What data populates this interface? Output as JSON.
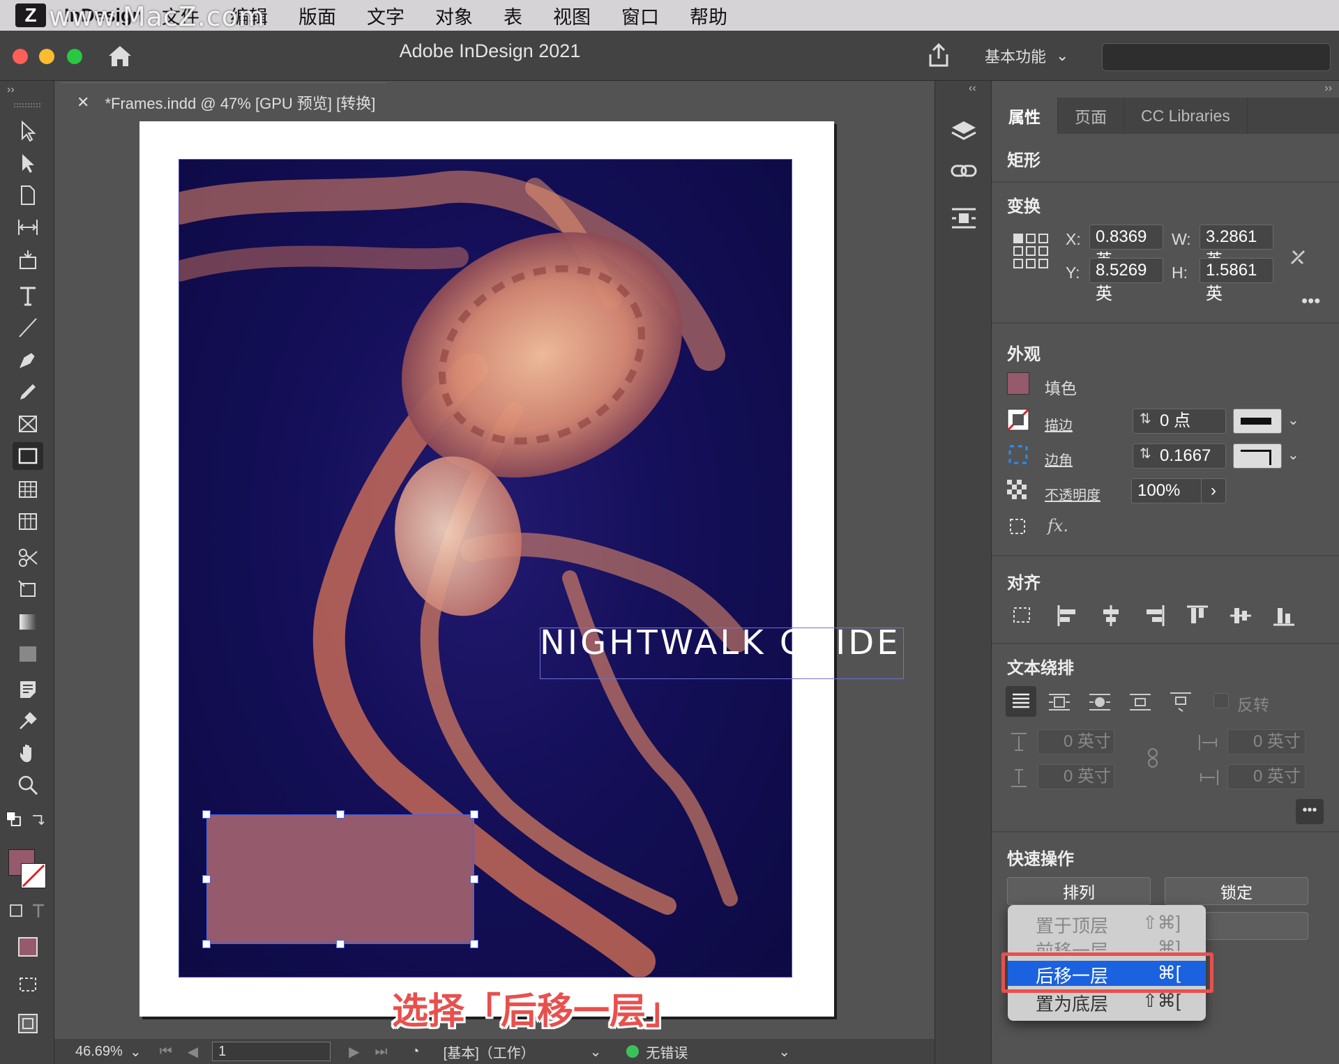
{
  "menubar": {
    "watermark": "www.MacZ.com",
    "app_name": "InDesign",
    "items": [
      "文件",
      "编辑",
      "版面",
      "文字",
      "对象",
      "表",
      "视图",
      "窗口",
      "帮助"
    ]
  },
  "titlebar": {
    "title": "Adobe InDesign 2021",
    "workspace": "基本功能"
  },
  "document": {
    "tab_label": "*Frames.indd @ 47% [GPU 预览] [转换]",
    "cover_title": "NIGHTWALK GUIDE"
  },
  "statusbar": {
    "zoom": "46.69%",
    "page": "1",
    "mode": "[基本]（工作）",
    "preflight": "无错误"
  },
  "panel": {
    "tabs": [
      "属性",
      "页面",
      "CC Libraries"
    ],
    "object_type": "矩形",
    "transform": {
      "title": "变换",
      "x_label": "X:",
      "x_value": "0.8369 英",
      "y_label": "Y:",
      "y_value": "8.5269 英",
      "w_label": "W:",
      "w_value": "3.2861 英",
      "h_label": "H:",
      "h_value": "1.5861 英"
    },
    "appearance": {
      "title": "外观",
      "fill_label": "填色",
      "fill_color": "#955a6c",
      "stroke_label": "描边",
      "stroke_value": "0 点",
      "corner_label": "边角",
      "corner_value": "0.1667",
      "opacity_label": "不透明度",
      "opacity_value": "100%",
      "fx_label": "fx."
    },
    "align": {
      "title": "对齐"
    },
    "text_wrap": {
      "title": "文本绕排",
      "invert_label": "反转",
      "offset_top": "0 英寸",
      "offset_bottom": "0 英寸",
      "offset_left": "0 英寸",
      "offset_right": "0 英寸"
    },
    "quick_actions": {
      "title": "快速操作",
      "arrange_label": "排列",
      "lock_label": "锁定"
    }
  },
  "context_menu": {
    "items": [
      {
        "label": "置于顶层",
        "shortcut": "⇧⌘]"
      },
      {
        "label": "前移一层",
        "shortcut": "⌘]"
      },
      {
        "label": "后移一层",
        "shortcut": "⌘["
      },
      {
        "label": "置为底层",
        "shortcut": "⇧⌘["
      }
    ]
  },
  "annotation": "选择「后移一层」",
  "colors": {
    "accent": "#1a62e0",
    "annotation": "#e8504d",
    "rect_fill": "#955a6c",
    "photo_background": "#140f58"
  }
}
